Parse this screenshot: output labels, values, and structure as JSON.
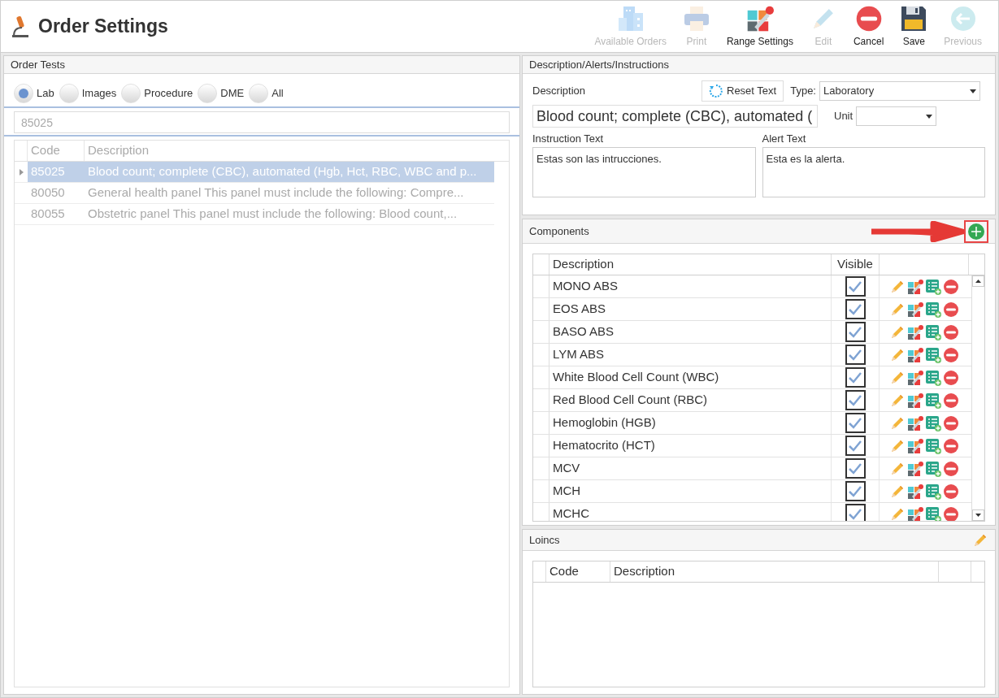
{
  "window": {
    "title": "Order Settings"
  },
  "toolbar": [
    {
      "label": "Available Orders",
      "kind": "orders",
      "disabled": true
    },
    {
      "label": "Print",
      "kind": "print",
      "disabled": true
    },
    {
      "label": "Range Settings",
      "kind": "range",
      "disabled": false
    },
    {
      "label": "Edit",
      "kind": "edit",
      "disabled": true
    },
    {
      "label": "Cancel",
      "kind": "cancel",
      "disabled": false
    },
    {
      "label": "Save",
      "kind": "save",
      "disabled": false
    },
    {
      "label": "Previous",
      "kind": "previous",
      "disabled": true
    }
  ],
  "order_tests": {
    "title": "Order Tests",
    "filters": [
      {
        "label": "Lab",
        "selected": true
      },
      {
        "label": "Images",
        "selected": false
      },
      {
        "label": "Procedure",
        "selected": false
      },
      {
        "label": "DME",
        "selected": false
      },
      {
        "label": "All",
        "selected": false
      }
    ],
    "search": {
      "value": "85025"
    },
    "columns": [
      "Code",
      "Description"
    ],
    "rows": [
      {
        "code": "85025",
        "description": "Blood count; complete (CBC), automated (Hgb, Hct, RBC, WBC and p...",
        "selected": true
      },
      {
        "code": "80050",
        "description": "General health panel This panel must include the following: Compre...",
        "selected": false
      },
      {
        "code": "80055",
        "description": "Obstetric panel This panel must include the following: Blood count,...",
        "selected": false
      }
    ]
  },
  "details": {
    "title": "Description/Alerts/Instructions",
    "description_label": "Description",
    "reset_button": "Reset Text",
    "type_label": "Type:",
    "type_value": "Laboratory",
    "description_value": "Blood count; complete (CBC), automated (",
    "unit_label": "Unit",
    "instruction_label": "Instruction Text",
    "instruction_value": "Estas son las intrucciones.",
    "alert_label": "Alert Text",
    "alert_value": "Esta es la alerta."
  },
  "components": {
    "title": "Components",
    "columns": [
      "Description",
      "Visible"
    ],
    "rows": [
      {
        "description": "MONO ABS",
        "visible": true
      },
      {
        "description": "EOS ABS",
        "visible": true
      },
      {
        "description": "BASO ABS",
        "visible": true
      },
      {
        "description": "LYM ABS",
        "visible": true
      },
      {
        "description": "White Blood Cell Count (WBC)",
        "visible": true
      },
      {
        "description": "Red Blood Cell Count (RBC)",
        "visible": true
      },
      {
        "description": "Hemoglobin (HGB)",
        "visible": true
      },
      {
        "description": "Hematocrito (HCT)",
        "visible": true
      },
      {
        "description": "MCV",
        "visible": true
      },
      {
        "description": "MCH",
        "visible": true
      },
      {
        "description": "MCHC",
        "visible": true
      }
    ]
  },
  "loincs": {
    "title": "Loincs",
    "columns": [
      "Code",
      "Description"
    ]
  }
}
